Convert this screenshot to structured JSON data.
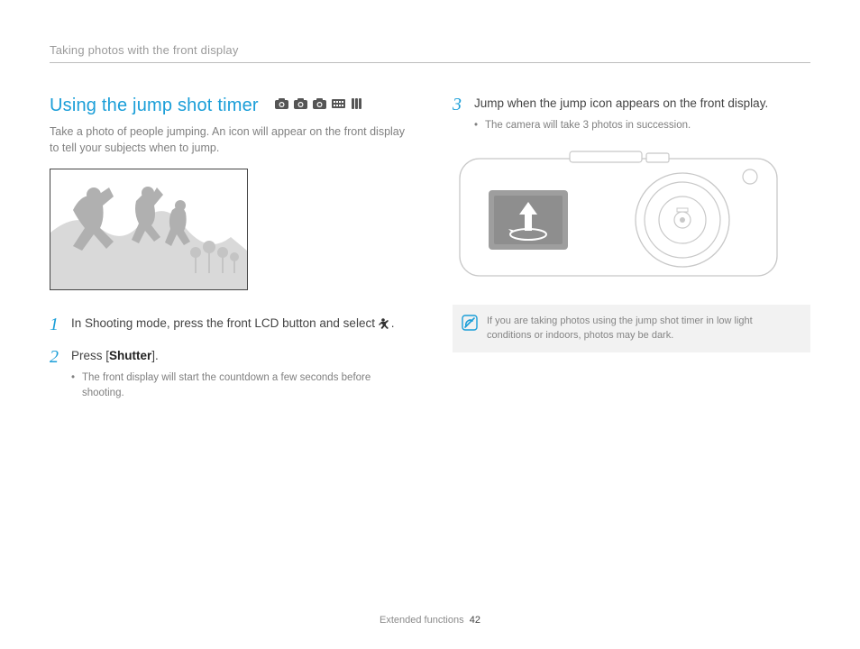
{
  "breadcrumb": "Taking photos with the front display",
  "title": "Using the jump shot timer",
  "mode_icons": [
    "camera-auto-icon",
    "camera-p-icon",
    "camera-smart-icon",
    "scene-icon",
    "dual-icon"
  ],
  "intro": "Take a photo of people jumping. An icon will appear on the front display to tell your subjects when to jump.",
  "steps": [
    {
      "num": "1",
      "text_before": "In Shooting mode, press the front LCD button and select ",
      "icon": "jump-person-icon",
      "text_after": "."
    },
    {
      "num": "2",
      "text_before": "Press [",
      "strong": "Shutter",
      "text_after": "].",
      "bullets": [
        "The front display will start the countdown a few seconds before shooting."
      ]
    },
    {
      "num": "3",
      "text_before": "Jump when the jump icon appears on the front display.",
      "bullets": [
        "The camera will take 3 photos in succession."
      ]
    }
  ],
  "note": "If you are taking photos using the jump shot timer in low light conditions or indoors, photos may be dark.",
  "footer_section": "Extended functions",
  "footer_page": "42"
}
